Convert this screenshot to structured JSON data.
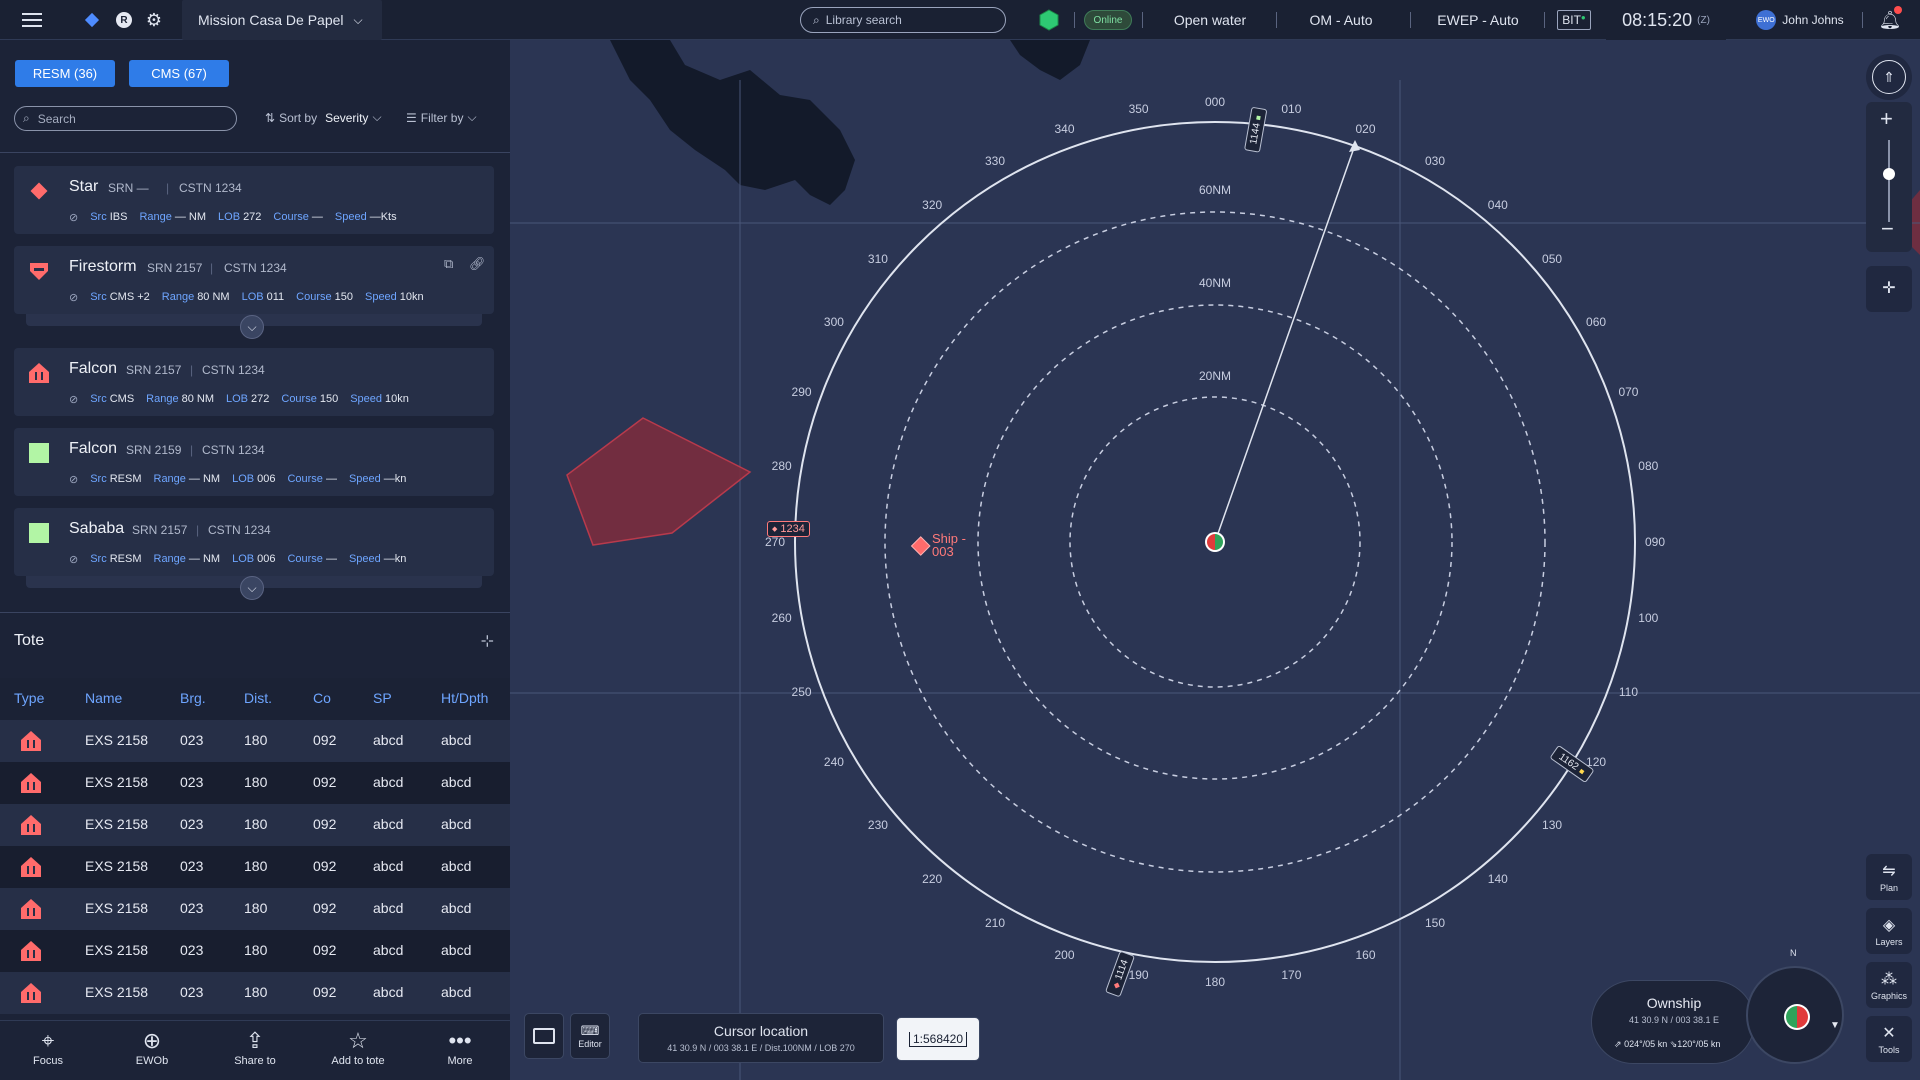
{
  "topbar": {
    "mission_name": "Mission Casa De Papel",
    "search_placeholder": "Library search",
    "status_online": "Online",
    "mode_water": "Open water",
    "mode_om": "OM - Auto",
    "mode_ewep": "EWEP - Auto",
    "bit_label": "BIT",
    "time": "08:15:20",
    "time_zone": "(Z)",
    "user_badge": "EWO",
    "user_name": "John Johns",
    "r_label": "R"
  },
  "tabs": [
    {
      "label": "RESM (36)"
    },
    {
      "label": "CMS (67)"
    }
  ],
  "list_controls": {
    "search_placeholder": "Search",
    "sort_label": "Sort by",
    "sort_value": "Severity",
    "filter_label": "Filter by"
  },
  "alerts": [
    {
      "name": "Star",
      "srn": "SRN —",
      "cstn": "CSTN 1234",
      "src": "IBS",
      "range": "— NM",
      "lob": "272",
      "course": "—",
      "speed": "—Kts",
      "icon": "diamond-icon",
      "color": "#ff6b6b"
    },
    {
      "name": "Firestorm",
      "srn": "SRN 2157",
      "cstn": "CSTN 1234",
      "src": "CMS +2",
      "range": "80 NM",
      "lob": "011",
      "course": "150",
      "speed": "10kn",
      "icon": "shield-icon",
      "color": "#ff6b6b"
    },
    {
      "name": "Falcon",
      "srn": "SRN 2157",
      "cstn": "CSTN 1234",
      "src": "CMS",
      "range": "80 NM",
      "lob": "272",
      "course": "150",
      "speed": "10kn",
      "icon": "hostile-ship-icon",
      "color": "#ff6b6b"
    },
    {
      "name": "Falcon",
      "srn": "SRN 2159",
      "cstn": "CSTN 1234",
      "src": "RESM",
      "range": "— NM",
      "lob": "006",
      "course": "—",
      "speed": "—kn",
      "icon": "square-icon",
      "color": "#b2f5a5"
    },
    {
      "name": "Sababa",
      "srn": "SRN 2157",
      "cstn": "CSTN 1234",
      "src": "RESM",
      "range": "— NM",
      "lob": "006",
      "course": "—",
      "speed": "—kn",
      "icon": "square-icon",
      "color": "#b2f5a5"
    }
  ],
  "row_labels": {
    "src": "Src",
    "range": "Range",
    "lob": "LOB",
    "course": "Course",
    "speed": "Speed"
  },
  "tote": {
    "title": "Tote",
    "columns": [
      "Type",
      "Name",
      "Brg.",
      "Dist.",
      "Co",
      "SP",
      "Ht/Dpth"
    ],
    "rows": [
      {
        "name": "EXS 2158",
        "brg": "023",
        "dist": "180",
        "co": "092",
        "sp": "abcd",
        "ht": "abcd"
      },
      {
        "name": "EXS 2158",
        "brg": "023",
        "dist": "180",
        "co": "092",
        "sp": "abcd",
        "ht": "abcd"
      },
      {
        "name": "EXS 2158",
        "brg": "023",
        "dist": "180",
        "co": "092",
        "sp": "abcd",
        "ht": "abcd"
      },
      {
        "name": "EXS 2158",
        "brg": "023",
        "dist": "180",
        "co": "092",
        "sp": "abcd",
        "ht": "abcd"
      },
      {
        "name": "EXS 2158",
        "brg": "023",
        "dist": "180",
        "co": "092",
        "sp": "abcd",
        "ht": "abcd"
      },
      {
        "name": "EXS 2158",
        "brg": "023",
        "dist": "180",
        "co": "092",
        "sp": "abcd",
        "ht": "abcd"
      },
      {
        "name": "EXS 2158",
        "brg": "023",
        "dist": "180",
        "co": "092",
        "sp": "abcd",
        "ht": "abcd"
      }
    ]
  },
  "bottom_actions": [
    {
      "label": "Focus",
      "icon": "focus-icon"
    },
    {
      "label": "EWOb",
      "icon": "plus-circle-icon"
    },
    {
      "label": "Share to",
      "icon": "share-icon"
    },
    {
      "label": "Add to tote",
      "icon": "star-icon"
    },
    {
      "label": "More",
      "icon": "more-icon"
    }
  ],
  "map": {
    "bearings": [
      "000",
      "010",
      "020",
      "030",
      "040",
      "050",
      "060",
      "070",
      "080",
      "090",
      "100",
      "110",
      "120",
      "130",
      "140",
      "150",
      "160",
      "170",
      "180",
      "190",
      "200",
      "210",
      "220",
      "230",
      "240",
      "250",
      "260",
      "270",
      "280",
      "290",
      "300",
      "310",
      "320",
      "330",
      "340",
      "350"
    ],
    "range_rings": [
      "20NM",
      "40NM",
      "60NM"
    ],
    "contact_ship": "Ship - 003",
    "ship_line1": "Ship -",
    "ship_line2": "003",
    "track_1234": "1234",
    "track_1144": "1144",
    "track_1162": "1162",
    "track_1114": "1114",
    "cursor_title": "Cursor location",
    "cursor_detail": "41 30.9 N / 003 38.1 E / Dist.100NM / LOB 270",
    "scale": "1:568420",
    "editor_label": "Editor",
    "ownship_title": "Ownship",
    "ownship_pos": "41 30.9 N / 003 38.1 E",
    "ownship_speed1": "024°/05 kn",
    "ownship_speed2": "120°/05 kn",
    "compass_n": "N",
    "rail": [
      {
        "label": "Plan",
        "icon": "plan-icon"
      },
      {
        "label": "Layers",
        "icon": "layers-icon"
      },
      {
        "label": "Graphics",
        "icon": "graphics-icon"
      },
      {
        "label": "Tools",
        "icon": "tools-icon"
      }
    ]
  },
  "colors": {
    "accent": "#2f7ce8",
    "hostile": "#ff6b6b",
    "friendly": "#b2f5a5",
    "panel": "#1c2337",
    "map": "#2b3553"
  }
}
